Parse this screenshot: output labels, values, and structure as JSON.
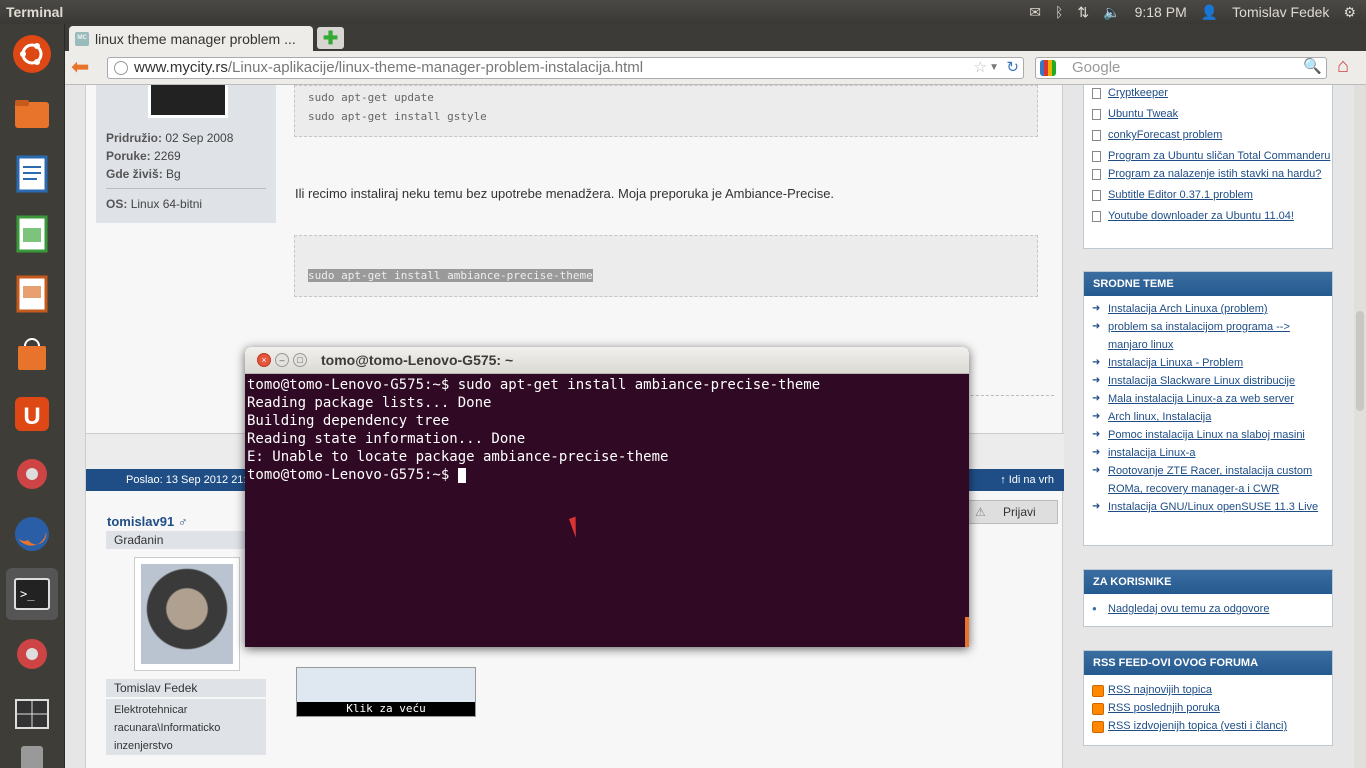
{
  "panel": {
    "app_title": "Terminal",
    "clock": "9:18 PM",
    "user": "Tomislav Fedek"
  },
  "launcher": {
    "items": [
      "ubuntu-logo",
      "home-folder",
      "libreoffice-writer",
      "libreoffice-calc",
      "libreoffice-impress",
      "ubuntu-software-center",
      "ubuntu-one",
      "system-settings",
      "firefox",
      "terminal",
      "system-settings-2",
      "workspace-switcher",
      "trash"
    ]
  },
  "browser": {
    "tab_title": "linux theme manager problem ...",
    "url_host": "www.mycity.rs",
    "url_path": "/Linux-aplikacije/linux-theme-manager-problem-instalacija.html",
    "search_placeholder": "Google"
  },
  "post1": {
    "joined_label": "Pridružio:",
    "joined": "02 Sep 2008",
    "posts_label": "Poruke:",
    "posts": "2269",
    "location_label": "Gde živiš:",
    "location": "Bg",
    "os_label": "OS:",
    "os": "Linux 64-bitni",
    "code1": [
      "sudo apt-get update",
      "sudo apt-get install gstyle"
    ],
    "text": "Ili recimo instaliraj neku temu bez upotrebe menadžera. Moja preporuka je Ambiance-Precise.",
    "code2": "sudo apt-get install ambiance-precise-theme"
  },
  "post2": {
    "posted": "Poslao: 13 Sep 2012 21:1",
    "goto_top": "Idi na vrh",
    "author": "tomislav91 ♂",
    "rank": "Građanin",
    "full_name": "Tomislav Fedek",
    "description": [
      "Elektrotehnicar",
      "racunara\\Informaticko",
      "inzenjerstvo"
    ],
    "report_button": "Prijavi",
    "thumb_caption": "Klik za veću"
  },
  "sidebar": {
    "recent_links": [
      "Cryptkeeper",
      "Ubuntu Tweak",
      "conkyForecast problem",
      "Program za Ubuntu sličan Total Commanderu",
      "Program za nalazenje istih stavki na hardu?",
      "Subtitle Editor 0.37.1 problem",
      "Youtube downloader za Ubuntu 11.04!"
    ],
    "related_title": "SRODNE TEME",
    "related_links": [
      "Instalacija Arch Linuxa (problem)",
      "problem sa instalacijom programa --> manjaro linux",
      "Instalacija Linuxa - Problem",
      "Instalacija Slackware Linux distribucije",
      "Mala instalacija Linux-a za web server",
      "Arch linux, Instalacija",
      "Pomoc instalacija Linux na slaboj masini",
      "instalacija Linux-a",
      "Rootovanje ZTE Racer, instalacija custom ROMa, recovery manager-a i CWR",
      "Instalacija GNU/Linux openSUSE 11.3 Live"
    ],
    "users_title": "ZA KORISNIKE",
    "users_links": [
      "Nadgledaj ovu temu za odgovore"
    ],
    "rss_title": "RSS FEED-OVI OVOG FORUMA",
    "rss_links": [
      "RSS najnovijih topica",
      "RSS poslednjih poruka",
      "RSS izdvojenijh topica (vesti i članci)"
    ]
  },
  "terminal": {
    "title": "tomo@tomo-Lenovo-G575: ~",
    "lines": [
      "tomo@tomo-Lenovo-G575:~$ sudo apt-get install ambiance-precise-theme",
      "Reading package lists... Done",
      "Building dependency tree",
      "Reading state information... Done",
      "E: Unable to locate package ambiance-precise-theme",
      "tomo@tomo-Lenovo-G575:~$ "
    ]
  }
}
